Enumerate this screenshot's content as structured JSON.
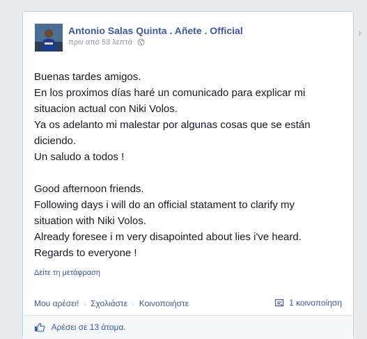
{
  "post": {
    "author": "Antonio Salas Quinta . Añete . Official",
    "timestamp": "πριν από 53 λεπτά",
    "privacy_icon": "globe-icon",
    "paragraphs_es": [
      "Buenas tardes amigos.",
      "En los proximos días haré un comunicado para explicar mi",
      "situacion actual con Niki Volos.",
      "Ya os adelanto mi malestar por algunas cosas que se están",
      "diciendo.",
      "Un saludo a todos !"
    ],
    "paragraphs_en": [
      "Good afternoon friends.",
      "Following days i will do an official statament to clarify my",
      "situation with Niki Volos.",
      "Already foresee i m very disapointed about lies i've heard.",
      "Regards to everyone !"
    ],
    "translate_link": "Δείτε τη μετάφραση"
  },
  "actions": {
    "like": "Μου αρέσει!",
    "comment": "Σχολιάστε",
    "share": "Κοινοποιήστε",
    "separator": "·",
    "shares_count": "1 κοινοποίηση"
  },
  "likes": {
    "text": "Αρέσει σε 13 άτομα."
  },
  "colors": {
    "link": "#3b5998",
    "text": "#141823",
    "muted": "#90949c",
    "background": "#e9ebee"
  }
}
